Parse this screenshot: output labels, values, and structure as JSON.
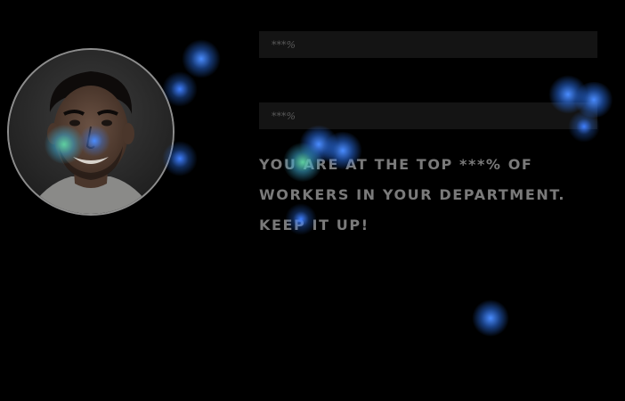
{
  "profile": {
    "avatar_icon": "person-portrait-icon"
  },
  "fields": [
    {
      "text": "***%"
    },
    {
      "text": "***%"
    }
  ],
  "message": {
    "text": "YOU ARE AT THE TOP ***% OF WORKERS IN YOUR DEPARTMENT. KEEP IT UP!"
  },
  "colors": {
    "background": "#000000",
    "field_background": "#141414",
    "text": "#7a7a7a",
    "heatmap_core": "#2f7bff",
    "heatmap_hot": "#3fbf7f"
  }
}
